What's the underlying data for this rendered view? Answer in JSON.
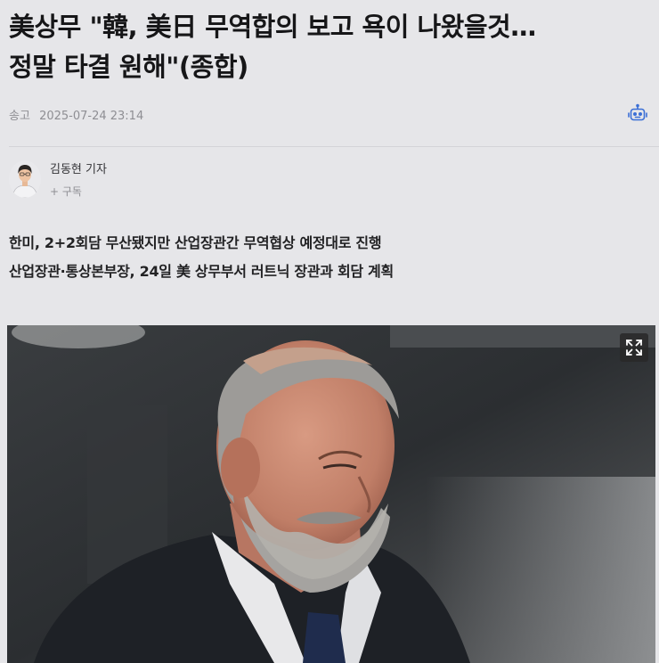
{
  "article": {
    "title_line1": "美상무 \"韓, 美日 무역합의 보고 욕이 나왔을것…",
    "title_line2": "정말 타결 원해\"(종합)",
    "meta_label": "송고",
    "meta_datetime": "2025-07-24 23:14",
    "author_name": "김동현 기자",
    "subscribe_label": "+ 구독",
    "subtitles": [
      "한미, 2+2회담 무산됐지만 산업장관간 무역협상 예정대로 진행",
      "산업장관·통상본부장, 24일 美 상무부서 러트닉 장관과 회담 계획"
    ]
  },
  "icons": {
    "ai_assistant": "robot-icon",
    "expand": "expand-icon"
  },
  "colors": {
    "background": "#e6e6e9",
    "accent": "#3b6fd6",
    "meta_text": "#8e8e93"
  }
}
